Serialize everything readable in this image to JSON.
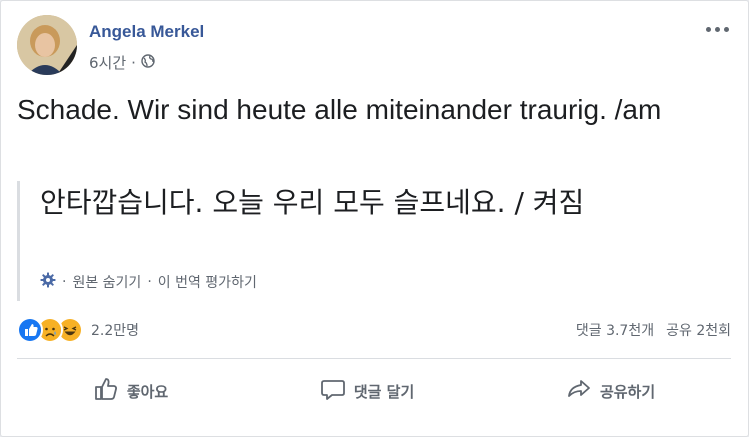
{
  "post": {
    "author": "Angela Merkel",
    "time": "6시간",
    "separator": "·",
    "privacy_icon": "globe-icon",
    "text": "Schade. Wir sind heute alle miteinander traurig. /am",
    "translation": {
      "text": "안타깝습니다. 오늘 우리 모두 슬프네요. / 켜짐",
      "sep1": "·",
      "hide_original": "원본 숨기기",
      "sep2": "·",
      "rate": "이 번역 평가하기"
    }
  },
  "stats": {
    "reactions_count": "2.2만명",
    "comments": "댓글 3.7천개",
    "shares": "공유 2천회"
  },
  "actions": {
    "like": "좋아요",
    "comment": "댓글 달기",
    "share": "공유하기"
  },
  "colors": {
    "author_link": "#385898",
    "like_blue": "#1877f2",
    "reaction_yellow": "#f7b125"
  }
}
